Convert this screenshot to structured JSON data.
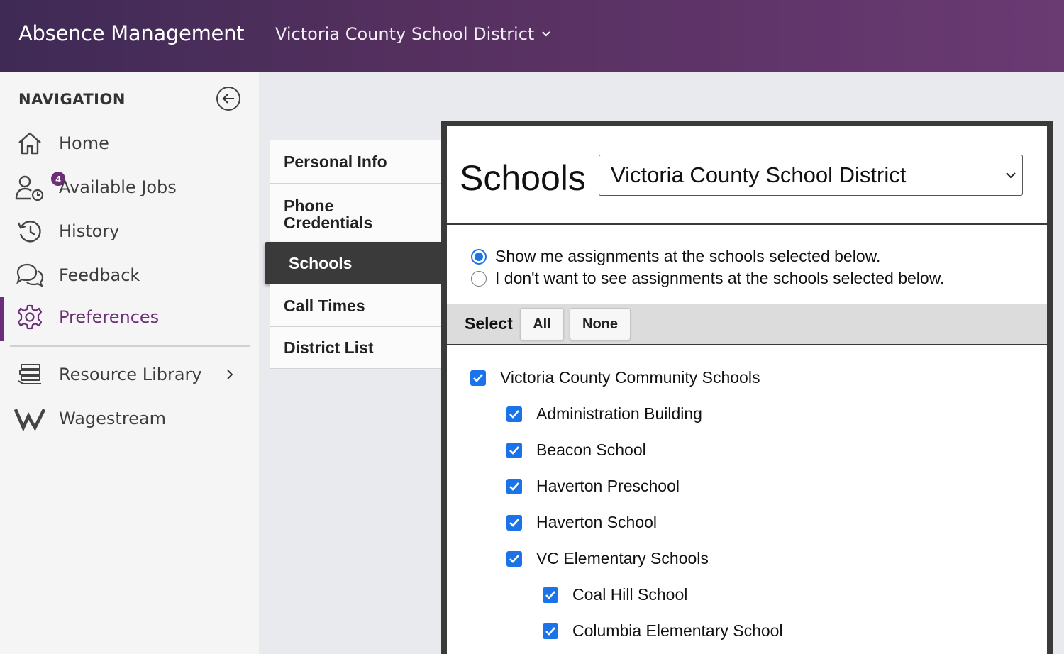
{
  "header": {
    "app_title": "Absence Management",
    "district": "Victoria County School District"
  },
  "sidebar": {
    "heading": "NAVIGATION",
    "items": [
      {
        "label": "Home",
        "icon": "home-icon"
      },
      {
        "label": "Available Jobs",
        "icon": "user-clock-icon",
        "badge": "4"
      },
      {
        "label": "History",
        "icon": "history-icon"
      },
      {
        "label": "Feedback",
        "icon": "chat-bubbles-icon"
      },
      {
        "label": "Preferences",
        "icon": "gear-icon",
        "active": true
      },
      {
        "label": "Resource Library",
        "icon": "book-stack-icon"
      },
      {
        "label": "Wagestream",
        "icon": "wagestream-logo-icon"
      }
    ]
  },
  "tabs": [
    {
      "label": "Personal Info"
    },
    {
      "label": "Phone Credentials"
    },
    {
      "label": "Schools",
      "active": true
    },
    {
      "label": "Call Times"
    },
    {
      "label": "District List"
    }
  ],
  "main": {
    "title": "Schools",
    "district_select": "Victoria County School District",
    "radio_show": "Show me assignments at the schools selected below.",
    "radio_hide": "I don't want to see assignments at the schools selected below.",
    "select_label": "Select",
    "all_button": "All",
    "none_button": "None",
    "schools": [
      {
        "name": "Victoria County Community Schools",
        "checked": true,
        "level": 0
      },
      {
        "name": "Administration Building",
        "checked": true,
        "level": 1
      },
      {
        "name": "Beacon School",
        "checked": true,
        "level": 1
      },
      {
        "name": "Haverton Preschool",
        "checked": true,
        "level": 1
      },
      {
        "name": "Haverton School",
        "checked": true,
        "level": 1
      },
      {
        "name": "VC Elementary Schools",
        "checked": true,
        "level": 1
      },
      {
        "name": "Coal Hill School",
        "checked": true,
        "level": 2
      },
      {
        "name": "Columbia Elementary School",
        "checked": true,
        "level": 2
      }
    ]
  },
  "colors": {
    "brand": "#6d2e79",
    "accent": "#1a73e8",
    "header_dark": "#3f2a55"
  }
}
